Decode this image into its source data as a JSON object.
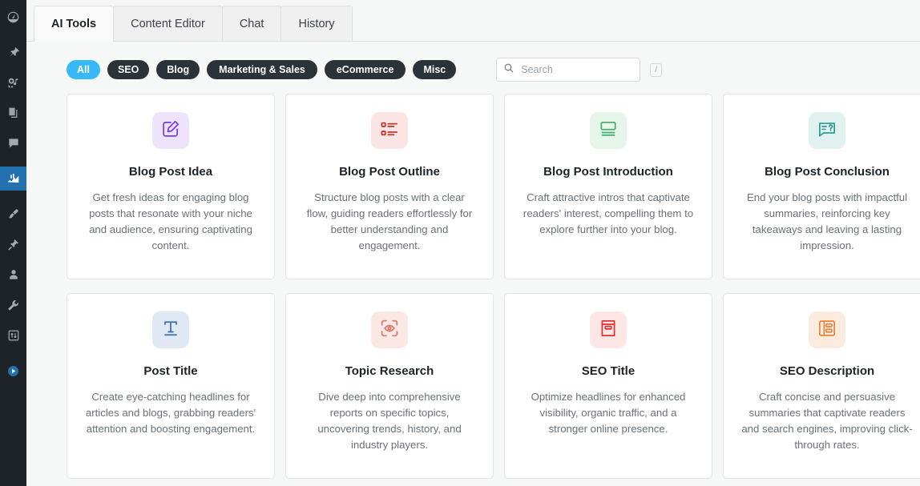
{
  "sidebar": {
    "items": [
      {
        "name": "dashboard",
        "icon": "dashboard-icon",
        "active": false
      },
      {
        "name": "posts",
        "icon": "pin-icon",
        "active": false
      },
      {
        "name": "media",
        "icon": "media-icon",
        "active": false
      },
      {
        "name": "pages",
        "icon": "pages-icon",
        "active": false
      },
      {
        "name": "comments",
        "icon": "comment-icon",
        "active": false
      },
      {
        "name": "analytics",
        "icon": "chart-icon",
        "active": true
      },
      {
        "name": "appearance",
        "icon": "brush-icon",
        "active": false
      },
      {
        "name": "plugins",
        "icon": "plug-icon",
        "active": false
      },
      {
        "name": "users",
        "icon": "user-icon",
        "active": false
      },
      {
        "name": "tools",
        "icon": "wrench-icon",
        "active": false
      },
      {
        "name": "settings",
        "icon": "sliders-icon",
        "active": false
      },
      {
        "name": "player",
        "icon": "play-circle-icon",
        "active": false
      }
    ]
  },
  "tabs": [
    {
      "label": "AI Tools",
      "active": true
    },
    {
      "label": "Content Editor",
      "active": false
    },
    {
      "label": "Chat",
      "active": false
    },
    {
      "label": "History",
      "active": false
    }
  ],
  "filters": [
    {
      "label": "All",
      "selected": true
    },
    {
      "label": "SEO",
      "selected": false
    },
    {
      "label": "Blog",
      "selected": false
    },
    {
      "label": "Marketing & Sales",
      "selected": false
    },
    {
      "label": "eCommerce",
      "selected": false
    },
    {
      "label": "Misc",
      "selected": false
    }
  ],
  "search": {
    "placeholder": "Search",
    "value": "",
    "shortcut": "/"
  },
  "cards": [
    {
      "title": "Blog Post Idea",
      "description": "Get fresh ideas for engaging blog posts that resonate with your niche and audience, ensuring captivating content.",
      "icon": "pencil-square-icon",
      "icon_color": "#7c3aed",
      "icon_bg": "#ede4fb"
    },
    {
      "title": "Blog Post Outline",
      "description": "Structure blog posts with a clear flow, guiding readers effortlessly for better understanding and engagement.",
      "icon": "bullet-list-icon",
      "icon_color": "#c0392b",
      "icon_bg": "#fbe4e4"
    },
    {
      "title": "Blog Post Introduction",
      "description": "Craft attractive intros that captivate readers' interest, compelling them to explore further into your blog.",
      "icon": "article-header-icon",
      "icon_color": "#4caf72",
      "icon_bg": "#e6f4ea"
    },
    {
      "title": "Blog Post Conclusion",
      "description": "End your blog posts with impactful summaries, reinforcing key takeaways and leaving a lasting impression.",
      "icon": "chat-question-icon",
      "icon_color": "#2a9d8f",
      "icon_bg": "#e1f1ef"
    },
    {
      "title": "Post Title",
      "description": "Create eye-catching headlines for articles and blogs, grabbing readers' attention and boosting engagement.",
      "icon": "text-title-icon",
      "icon_color": "#3c6ea5",
      "icon_bg": "#dfe8f3"
    },
    {
      "title": "Topic Research",
      "description": "Dive deep into comprehensive reports on specific topics, uncovering trends, history, and industry players.",
      "icon": "eye-scan-icon",
      "icon_color": "#d4786a",
      "icon_bg": "#fbe8e4"
    },
    {
      "title": "SEO Title",
      "description": "Optimize headlines for enhanced visibility, organic traffic, and a stronger online presence.",
      "icon": "archive-box-icon",
      "icon_color": "#e03131",
      "icon_bg": "#fce6e6"
    },
    {
      "title": "SEO Description",
      "description": "Craft concise and persuasive summaries that captivate readers and search engines, improving click-through rates.",
      "icon": "document-layout-icon",
      "icon_color": "#e8853c",
      "icon_bg": "#fcecdf"
    }
  ],
  "colors": {
    "accent": "#36b9f6",
    "chip_bg": "#2c3338",
    "sidebar_bg": "#1d2327",
    "sidebar_active": "#2271b1"
  }
}
